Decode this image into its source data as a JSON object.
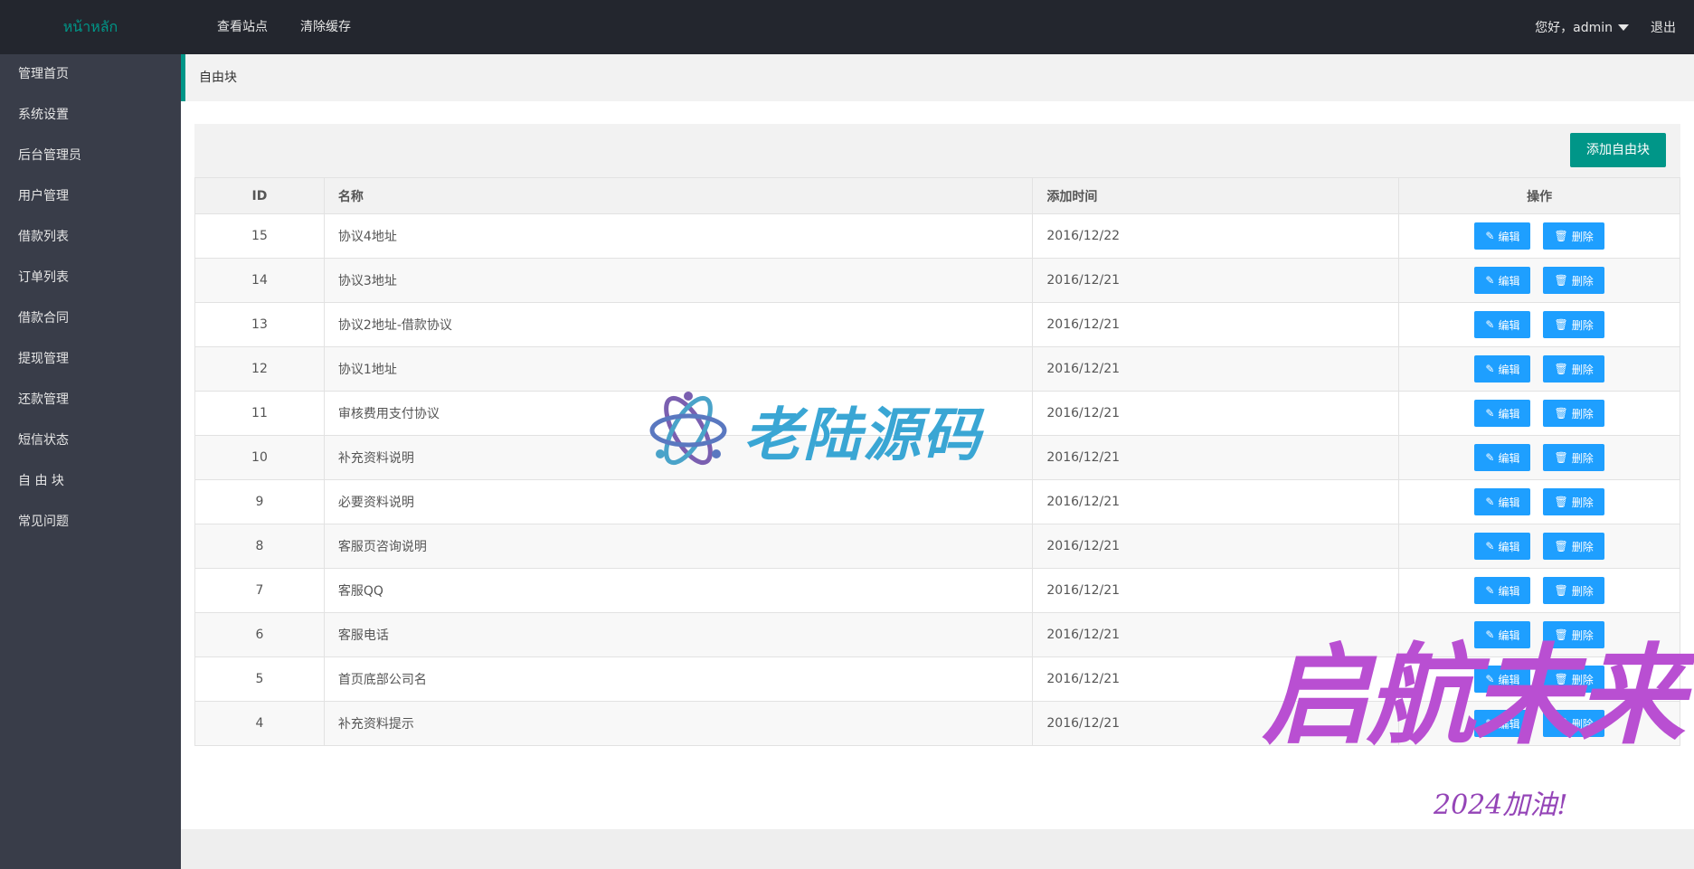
{
  "header": {
    "logo": "หน้าหลัก",
    "nav": [
      "查看站点",
      "清除缓存"
    ],
    "user": "您好，admin",
    "logout": "退出"
  },
  "sidebar": {
    "items": [
      "管理首页",
      "系统设置",
      "后台管理员",
      "用户管理",
      "借款列表",
      "订单列表",
      "借款合同",
      "提现管理",
      "还款管理",
      "短信状态",
      "自 由 块",
      "常见问题"
    ]
  },
  "breadcrumb": "自由块",
  "toolbar": {
    "add_label": "添加自由块"
  },
  "table": {
    "headers": {
      "id": "ID",
      "name": "名称",
      "time": "添加时间",
      "op": "操作"
    },
    "edit_label": "编辑",
    "delete_label": "删除",
    "rows": [
      {
        "id": "15",
        "name": "协议4地址",
        "time": "2016/12/22"
      },
      {
        "id": "14",
        "name": "协议3地址",
        "time": "2016/12/21"
      },
      {
        "id": "13",
        "name": "协议2地址-借款协议",
        "time": "2016/12/21"
      },
      {
        "id": "12",
        "name": "协议1地址",
        "time": "2016/12/21"
      },
      {
        "id": "11",
        "name": "审核费用支付协议",
        "time": "2016/12/21"
      },
      {
        "id": "10",
        "name": "补充资料说明",
        "time": "2016/12/21"
      },
      {
        "id": "9",
        "name": "必要资料说明",
        "time": "2016/12/21"
      },
      {
        "id": "8",
        "name": "客服页咨询说明",
        "time": "2016/12/21"
      },
      {
        "id": "7",
        "name": "客服QQ",
        "time": "2016/12/21"
      },
      {
        "id": "6",
        "name": "客服电话",
        "time": "2016/12/21"
      },
      {
        "id": "5",
        "name": "首页底部公司名",
        "time": "2016/12/21"
      },
      {
        "id": "4",
        "name": "补充资料提示",
        "time": "2016/12/21"
      }
    ]
  },
  "watermarks": {
    "brand": "老陆源码",
    "slogan": "启航未来",
    "slogan_sub": "2024加油!"
  },
  "colors": {
    "topbar": "#23262e",
    "sidebar": "#393d49",
    "accent": "#009688",
    "button_blue": "#1e9fff"
  }
}
